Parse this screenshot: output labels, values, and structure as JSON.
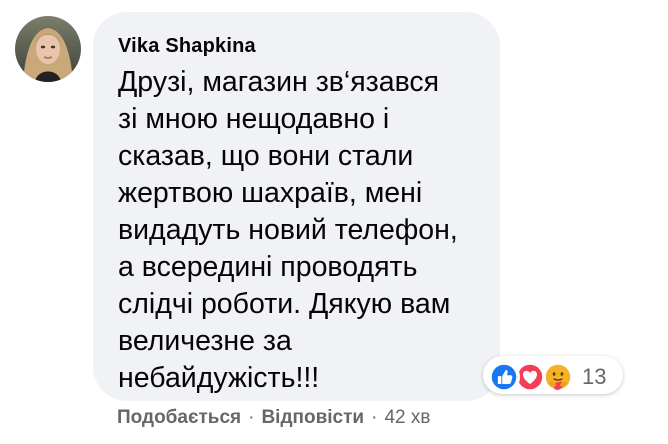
{
  "comment": {
    "author": "Vika Shapkina",
    "text": "Друзі, магазин зв‘язався\nзі мною нещодавно і\nсказав, що вони стали\nжертвою шахраїв, мені\nвидадуть новий телефон,\nа всередині проводять\nслідчі роботи. Дякую вам\nвеличезне за\nнебайдужість!!!",
    "reactions": {
      "icons": [
        "like-icon",
        "love-icon",
        "care-icon"
      ],
      "count": "13"
    },
    "actions": {
      "like_label": "Подобається",
      "separator": "·",
      "reply_label": "Відповісти",
      "time": "42 хв"
    }
  },
  "colors": {
    "bubble_bg": "#f0f2f5",
    "text": "#050505",
    "secondary_text": "#65676b",
    "like_blue": "#1877f2",
    "love_red": "#f33e58",
    "care_yellow": "#f7b125"
  }
}
